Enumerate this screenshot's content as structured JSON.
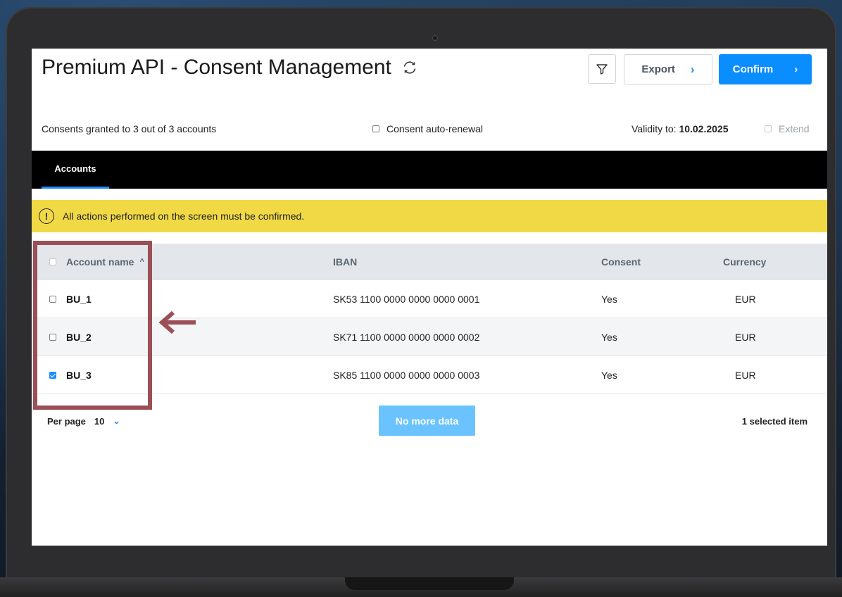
{
  "page": {
    "title": "Premium API - Consent Management"
  },
  "toolbar": {
    "filter_icon": "funnel-icon",
    "export_label": "Export",
    "confirm_label": "Confirm"
  },
  "infobar": {
    "consents_text": "Consents granted to 3 out of 3 accounts",
    "auto_renewal_label": "Consent auto-renewal",
    "auto_renewal_checked": false,
    "validity_label": "Validity to: ",
    "validity_date": "10.02.2025",
    "extend_label": "Extend",
    "extend_checked": false
  },
  "tabs": [
    {
      "label": "Accounts",
      "active": true
    }
  ],
  "alert": {
    "icon": "!",
    "text": "All actions performed on the screen must be confirmed."
  },
  "table": {
    "columns": [
      "Account name",
      "IBAN",
      "Consent",
      "Currency"
    ],
    "rows": [
      {
        "name": "BU_1",
        "iban": "SK53 1100 0000 0000 0000 0001",
        "consent": "Yes",
        "currency": "EUR",
        "selected": false
      },
      {
        "name": "BU_2",
        "iban": "SK71 1100 0000 0000 0000 0002",
        "consent": "Yes",
        "currency": "EUR",
        "selected": false
      },
      {
        "name": "BU_3",
        "iban": "SK85 1100 0000 0000 0000 0003",
        "consent": "Yes",
        "currency": "EUR",
        "selected": true
      }
    ]
  },
  "footer": {
    "per_page_label": "Per page",
    "per_page_value": "10",
    "no_more_data_label": "No more data",
    "selected_text": "1 selected item"
  },
  "colors": {
    "accent": "#0a8dff",
    "alert_bg": "#f1d945",
    "highlight": "#9b4f56",
    "tab_bar": "#000000"
  }
}
